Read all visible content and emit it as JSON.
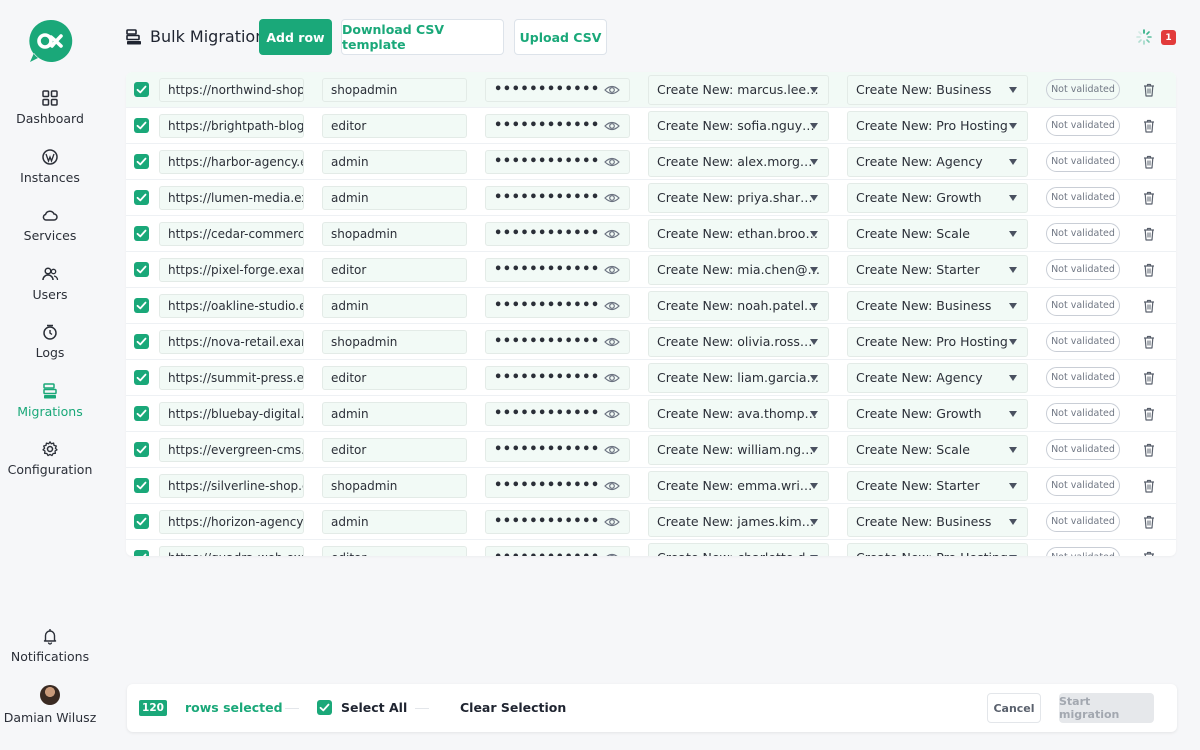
{
  "header": {
    "title": "Bulk Migration",
    "add_row": "Add row",
    "download_csv": "Download CSV template",
    "upload_csv": "Upload CSV",
    "notification_count": "1"
  },
  "sidebar": {
    "items": [
      {
        "label": "Dashboard",
        "icon": "grid-icon"
      },
      {
        "label": "Instances",
        "icon": "wordpress-icon"
      },
      {
        "label": "Services",
        "icon": "cloud-icon"
      },
      {
        "label": "Users",
        "icon": "users-icon"
      },
      {
        "label": "Logs",
        "icon": "clock-icon"
      },
      {
        "label": "Migrations",
        "icon": "migration-icon",
        "active": true
      },
      {
        "label": "Configuration",
        "icon": "gear-icon"
      }
    ],
    "notifications": "Notifications",
    "user_name": "Damian Wilusz"
  },
  "table": {
    "rows": [
      {
        "url": "https://northwind-shop.",
        "username": "shopadmin",
        "password": "••••••••••••",
        "account": "Create New: marcus.lee…",
        "plan": "Create New: Business",
        "status": "Not validated"
      },
      {
        "url": "https://brightpath-blog.",
        "username": "editor",
        "password": "••••••••••••",
        "account": "Create New: sofia.nguy…",
        "plan": "Create New: Pro Hosting",
        "status": "Not validated"
      },
      {
        "url": "https://harbor-agency.e",
        "username": "admin",
        "password": "••••••••••••",
        "account": "Create New: alex.morg…",
        "plan": "Create New: Agency",
        "status": "Not validated"
      },
      {
        "url": "https://lumen-media.ex",
        "username": "admin",
        "password": "••••••••••••",
        "account": "Create New: priya.shar…",
        "plan": "Create New: Growth",
        "status": "Not validated"
      },
      {
        "url": "https://cedar-commerce",
        "username": "shopadmin",
        "password": "••••••••••••",
        "account": "Create New: ethan.broo…",
        "plan": "Create New: Scale",
        "status": "Not validated"
      },
      {
        "url": "https://pixel-forge.exam",
        "username": "editor",
        "password": "••••••••••••",
        "account": "Create New: mia.chen@…",
        "plan": "Create New: Starter",
        "status": "Not validated"
      },
      {
        "url": "https://oakline-studio.e",
        "username": "admin",
        "password": "••••••••••••",
        "account": "Create New: noah.patel…",
        "plan": "Create New: Business",
        "status": "Not validated"
      },
      {
        "url": "https://nova-retail.exam",
        "username": "shopadmin",
        "password": "••••••••••••",
        "account": "Create New: olivia.ross…",
        "plan": "Create New: Pro Hosting",
        "status": "Not validated"
      },
      {
        "url": "https://summit-press.ex",
        "username": "editor",
        "password": "••••••••••••",
        "account": "Create New: liam.garcia…",
        "plan": "Create New: Agency",
        "status": "Not validated"
      },
      {
        "url": "https://bluebay-digital.e",
        "username": "admin",
        "password": "••••••••••••",
        "account": "Create New: ava.thomp…",
        "plan": "Create New: Growth",
        "status": "Not validated"
      },
      {
        "url": "https://evergreen-cms.e",
        "username": "editor",
        "password": "••••••••••••",
        "account": "Create New: william.ng…",
        "plan": "Create New: Scale",
        "status": "Not validated"
      },
      {
        "url": "https://silverline-shop.e",
        "username": "shopadmin",
        "password": "••••••••••••",
        "account": "Create New: emma.wri…",
        "plan": "Create New: Starter",
        "status": "Not validated"
      },
      {
        "url": "https://horizon-agency.e",
        "username": "admin",
        "password": "••••••••••••",
        "account": "Create New: james.kim…",
        "plan": "Create New: Business",
        "status": "Not validated"
      },
      {
        "url": "https://quadra-web.exa",
        "username": "editor",
        "password": "••••••••••••",
        "account": "Create New: charlotte.d…",
        "plan": "Create New: Pro Hosting",
        "status": "Not validated"
      }
    ]
  },
  "bottom_bar": {
    "count": "120",
    "rows_selected": "rows selected",
    "select_all": "Select All",
    "clear_selection": "Clear Selection",
    "cancel": "Cancel",
    "start_migration": "Start migration"
  },
  "colors": {
    "accent": "#1aa879",
    "badge_red": "#e23b3b"
  }
}
